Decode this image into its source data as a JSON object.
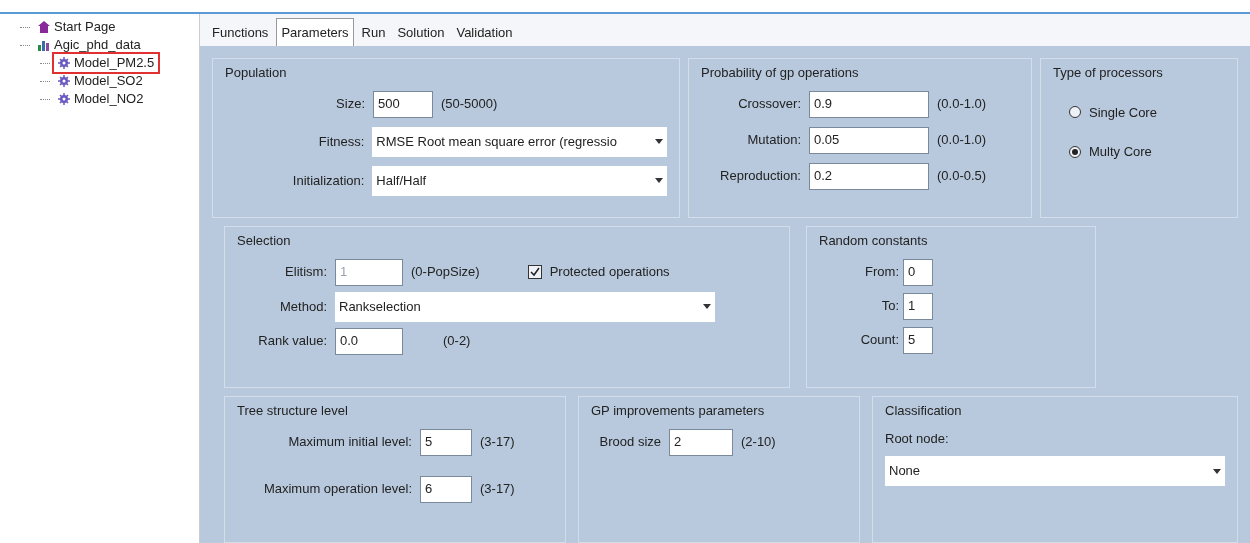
{
  "tree": [
    {
      "label": "Start Page",
      "kind": "page",
      "highlighted": false
    },
    {
      "label": "Agic_phd_data",
      "kind": "folder",
      "highlighted": false,
      "children": [
        {
          "label": "Model_PM2.5",
          "kind": "model",
          "highlighted": true
        },
        {
          "label": "Model_SO2",
          "kind": "model",
          "highlighted": false
        },
        {
          "label": "Model_NO2",
          "kind": "model",
          "highlighted": false
        }
      ]
    }
  ],
  "tabs": [
    {
      "label": "Functions",
      "selected": false
    },
    {
      "label": "Parameters",
      "selected": true
    },
    {
      "label": "Run",
      "selected": false
    },
    {
      "label": "Solution",
      "selected": false
    },
    {
      "label": "Validation",
      "selected": false
    }
  ],
  "population": {
    "title": "Population",
    "fields": [
      {
        "label": "Size:",
        "kind": "text",
        "value": "500",
        "hint": "(50-5000)"
      },
      {
        "label": "Fitness:",
        "kind": "select",
        "value": "RMSE Root mean square error (regressio"
      },
      {
        "label": "Initialization:",
        "kind": "select",
        "value": "Half/Half"
      }
    ]
  },
  "probability": {
    "title": "Probability of gp operations",
    "fields": [
      {
        "label": "Crossover:",
        "kind": "text",
        "value": "0.9",
        "hint": "(0.0-1.0)"
      },
      {
        "label": "Mutation:",
        "kind": "text",
        "value": "0.05",
        "hint": "(0.0-1.0)"
      },
      {
        "label": "Reproduction:",
        "kind": "text",
        "value": "0.2",
        "hint": "(0.0-0.5)"
      }
    ]
  },
  "processors": {
    "title": "Type of processors",
    "options": [
      {
        "label": "Single Core",
        "selected": false
      },
      {
        "label": "Multy Core",
        "selected": true
      }
    ]
  },
  "selection": {
    "title": "Selection",
    "elitism": {
      "label": "Elitism:",
      "value": "1",
      "hint": "(0-PopSize)",
      "disabled": true
    },
    "protected": {
      "label": "Protected operations",
      "checked": true
    },
    "method": {
      "label": "Method:",
      "value": "Rankselection"
    },
    "rank": {
      "label": "Rank value:",
      "value": "0.0",
      "hint": "(0-2)"
    }
  },
  "random_constants": {
    "title": "Random constants",
    "fields": [
      {
        "label": "From:",
        "value": "0"
      },
      {
        "label": "To:",
        "value": "1"
      },
      {
        "label": "Count:",
        "value": "5"
      }
    ]
  },
  "tree_structure": {
    "title": "Tree structure level",
    "fields": [
      {
        "label": "Maximum initial level:",
        "kind": "text",
        "value": "5",
        "hint": "(3-17)"
      },
      {
        "label": "Maximum operation level:",
        "kind": "text",
        "value": "6",
        "hint": "(3-17)"
      }
    ]
  },
  "gp_improvements": {
    "title": "GP improvements parameters",
    "fields": [
      {
        "label": "Brood size",
        "kind": "text",
        "value": "2",
        "hint": "(2-10)"
      }
    ]
  },
  "classification": {
    "title": "Classification",
    "label": "Root node:",
    "value": "None"
  }
}
